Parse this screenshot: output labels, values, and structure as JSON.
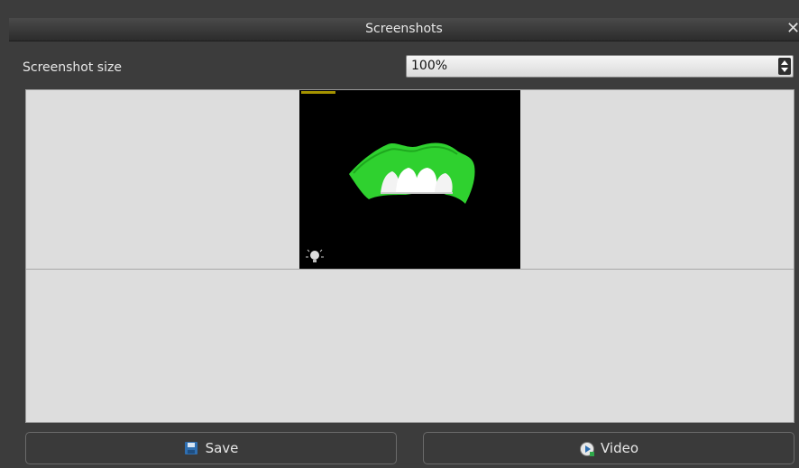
{
  "window": {
    "title": "Screenshots"
  },
  "screenshot_size": {
    "label": "Screenshot size",
    "value": "100%"
  },
  "buttons": {
    "save": "Save",
    "video": "Video"
  },
  "preview": {
    "description_icon": "dental-model-preview",
    "colors": {
      "background": "#000000",
      "gum": "#2fd12f",
      "teeth": "#f2f2f2"
    }
  }
}
